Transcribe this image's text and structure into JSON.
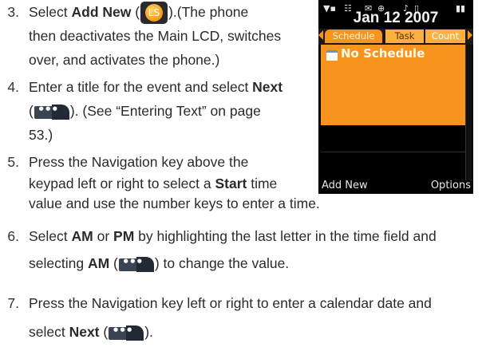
{
  "steps": [
    {
      "number": "3.",
      "lines": [
        {
          "pre": "Select ",
          "bold": "Add New",
          "mid": " (",
          "post": ").(The phone"
        },
        {
          "text": "then deactivates the Main LCD, switches"
        },
        {
          "text": "over, and activates the phone.)"
        }
      ]
    },
    {
      "number": "4.",
      "lines": [
        {
          "pre": "Enter a title for the event and select ",
          "bold": "Next"
        },
        {
          "pre": "(",
          "post": "). (See “Entering Text” on page"
        },
        {
          "text": "53.)"
        }
      ]
    },
    {
      "number": "5.",
      "lines": [
        {
          "text": "Press the Navigation key above the"
        },
        {
          "pre": "keypad left or right to select a ",
          "bold": "Start",
          "post": " time"
        },
        {
          "text": "value and use the number keys to enter a time."
        }
      ]
    },
    {
      "number": "6.",
      "lines": [
        {
          "pre": "Select ",
          "bold": "AM",
          "mid": " or ",
          "bold2": "PM",
          "post": " by highlighting the last letter in the time field and"
        },
        {
          "pre": "selecting ",
          "bold": "AM",
          "mid": " (",
          "post": ") to change the value."
        }
      ]
    },
    {
      "number": "7.",
      "lines": [
        {
          "text": "Press the Navigation key left or right to enter a calendar date and"
        },
        {
          "pre": "select ",
          "bold": "Next",
          "mid": " (",
          "post": ")."
        }
      ]
    }
  ],
  "icons": {
    "add_new_key": {
      "name": "ls-key-icon",
      "label": "LS"
    },
    "softkey": {
      "name": "softkey-icon",
      "glyph": "•••"
    }
  },
  "phone": {
    "date": "Jan 12 2007",
    "tabs": [
      "Schedule",
      "Task",
      "Count"
    ],
    "content": "No Schedule",
    "softkey_left": "Add New",
    "softkey_right": "Options",
    "accent_color": "#f7941d"
  }
}
